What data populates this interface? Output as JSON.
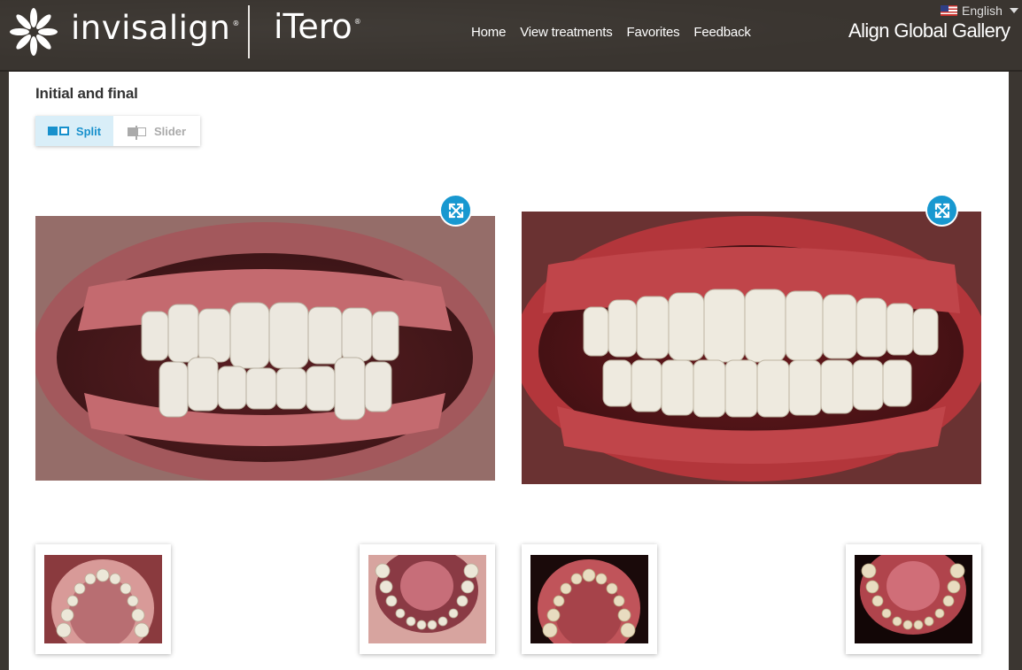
{
  "header": {
    "brand_primary": "invisalign",
    "brand_secondary": "iTero",
    "site_title": "Align Global Gallery",
    "nav": [
      "Home",
      "View treatments",
      "Favorites",
      "Feedback"
    ],
    "language": "English",
    "language_flag_icon": "us-flag-icon"
  },
  "section": {
    "title": "Initial and final",
    "view_modes": {
      "split_label": "Split",
      "slider_label": "Slider",
      "active": "Split"
    }
  },
  "colors": {
    "header_bg": "#3a3530",
    "accent_blue": "#1898d0",
    "active_toggle_bg": "#d9eef8"
  },
  "photos": {
    "initial": {
      "name": "initial-frontal-photo",
      "expand_icon": "expand-icon"
    },
    "final": {
      "name": "final-frontal-photo",
      "expand_icon": "expand-icon"
    }
  },
  "thumbnails": [
    {
      "name": "initial-upper-occlusal-thumbnail"
    },
    {
      "name": "initial-lower-occlusal-thumbnail"
    },
    {
      "name": "final-upper-occlusal-thumbnail"
    },
    {
      "name": "final-lower-occlusal-thumbnail"
    }
  ]
}
